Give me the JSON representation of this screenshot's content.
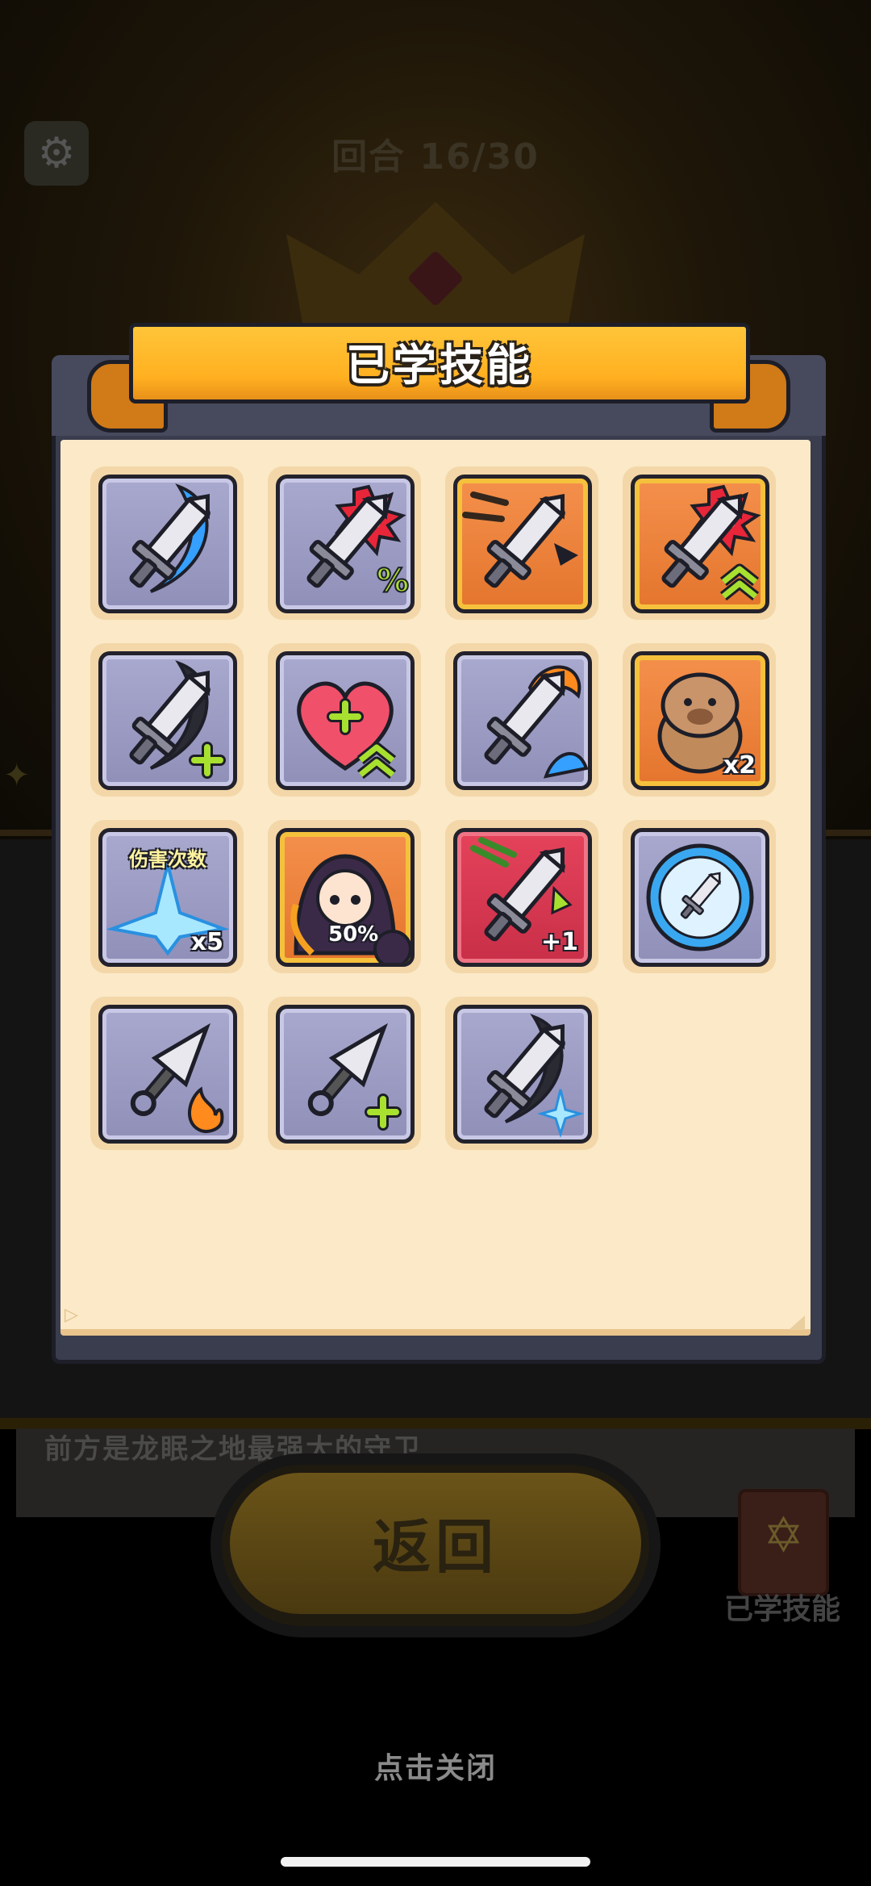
{
  "background": {
    "round_label": "回合 16/30",
    "dialog_text": "前方是龙眠之地最强大的守卫",
    "return_button": "返回",
    "skills_book_label": "已学技能",
    "close_hint": "点击关闭"
  },
  "modal": {
    "title": "已学技能",
    "skills": [
      {
        "name": "sword-crescent-slash",
        "frame": "purple",
        "badge": ""
      },
      {
        "name": "sword-crit-rate",
        "frame": "purple",
        "badge": ""
      },
      {
        "name": "sword-dash-strike",
        "frame": "orange",
        "badge": ""
      },
      {
        "name": "sword-crit-damage-up",
        "frame": "orange",
        "badge": ""
      },
      {
        "name": "sword-attack-plus",
        "frame": "purple",
        "badge": ""
      },
      {
        "name": "heart-health-up",
        "frame": "purple",
        "badge": ""
      },
      {
        "name": "sword-fire-wave",
        "frame": "purple",
        "badge": ""
      },
      {
        "name": "capybara-double",
        "frame": "orange",
        "badge": "x2"
      },
      {
        "name": "damage-count",
        "frame": "purple",
        "badge": "x5",
        "top_text": "伤害次数"
      },
      {
        "name": "companion-heal",
        "frame": "orange",
        "badge": "50%"
      },
      {
        "name": "sword-extra-hit",
        "frame": "red",
        "badge": "+1"
      },
      {
        "name": "sword-shield-bubble",
        "frame": "purple",
        "badge": ""
      },
      {
        "name": "kunai-fire",
        "frame": "purple",
        "badge": ""
      },
      {
        "name": "kunai-plus",
        "frame": "purple",
        "badge": ""
      },
      {
        "name": "sword-ice-slash",
        "frame": "purple",
        "badge": ""
      }
    ]
  },
  "colors": {
    "ribbon": "#ffb020",
    "paper": "#fbe9c8",
    "frame_purple": "#9a9ac2",
    "frame_orange": "#e87d35",
    "frame_red": "#d93650",
    "accent_green": "#a8e030"
  }
}
